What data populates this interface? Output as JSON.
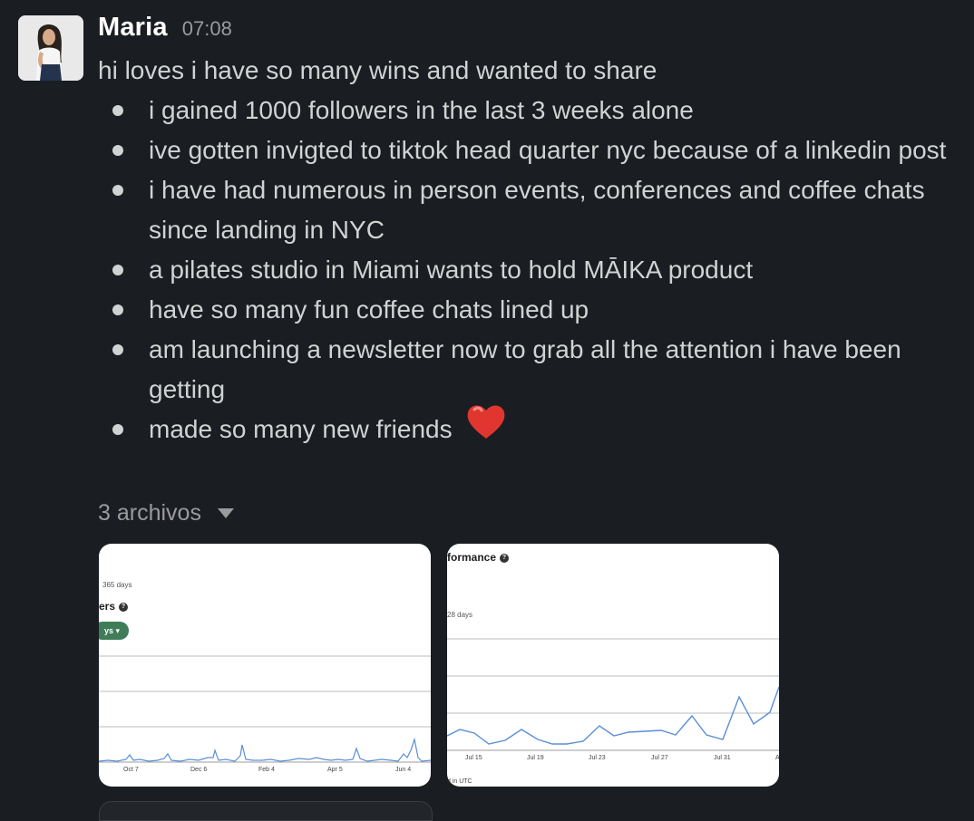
{
  "message": {
    "author": "Maria",
    "time": "07:08",
    "intro": "hi loves i have so many wins and wanted to share",
    "wins": [
      "i gained 1000 followers in the last 3 weeks alone",
      "ive gotten invigted to tiktok head quarter nyc because of a linkedin post",
      "i have had numerous in person events, conferences and coffee chats since landing in NYC",
      "a pilates studio in Miami wants to hold MĀIKA product",
      "have so many fun coffee chats lined up",
      "am launching a newsletter now to grab all the attention i have been getting",
      "made so many new friends"
    ],
    "last_win_emoji": "heart-emoji"
  },
  "files": {
    "toggle_label": "3 archivos",
    "attachments": [
      {
        "period_label": "365 days",
        "heading": "ers",
        "pill": "ys ▾",
        "ticks": [
          "Oct 7",
          "Dec 6",
          "Feb 4",
          "Apr 5",
          "Jun 4"
        ]
      },
      {
        "heading": "formance",
        "period_label": "28 days",
        "ticks": [
          "Jul 15",
          "Jul 19",
          "Jul 23",
          "Jul 27",
          "Jul 31",
          "A"
        ],
        "footer": "d in UTC"
      }
    ]
  },
  "colors": {
    "background": "#1a1d21",
    "text": "#d1d2d3",
    "muted": "#9a9b9d",
    "chart_line": "#5a8fd6",
    "pill": "#3f7c5a"
  }
}
